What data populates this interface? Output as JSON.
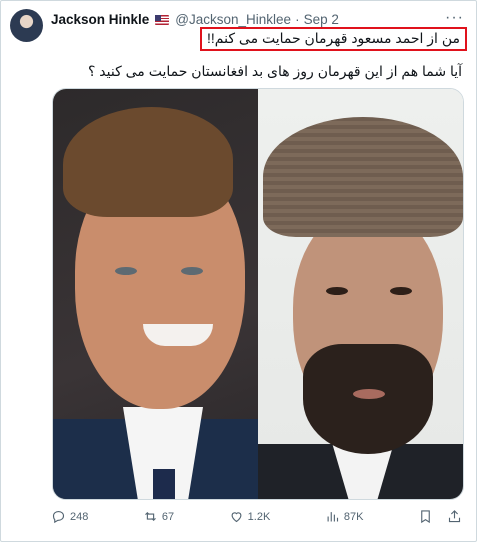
{
  "tweet": {
    "author_name": "Jackson Hinkle",
    "author_flag": "us-flag-icon",
    "handle": "@Jackson_Hinklee",
    "separator": "·",
    "date": "Sep 2",
    "more_label": "···",
    "line1": "من از احمد مسعود قهرمان حمایت می کنم!!",
    "line2": "آیا شما هم از این قهرمان روز های بد افغانستان حمایت می کنید ؟",
    "highlight_color": "#e0121c"
  },
  "actions": {
    "replies": "248",
    "reposts": "67",
    "likes": "1.2K",
    "views": "87K",
    "icons": [
      "reply-icon",
      "repost-icon",
      "like-icon",
      "views-icon",
      "bookmark-icon",
      "share-icon"
    ]
  },
  "colors": {
    "text": "#0f1419",
    "secondary": "#536471",
    "border": "#cfd9de"
  }
}
